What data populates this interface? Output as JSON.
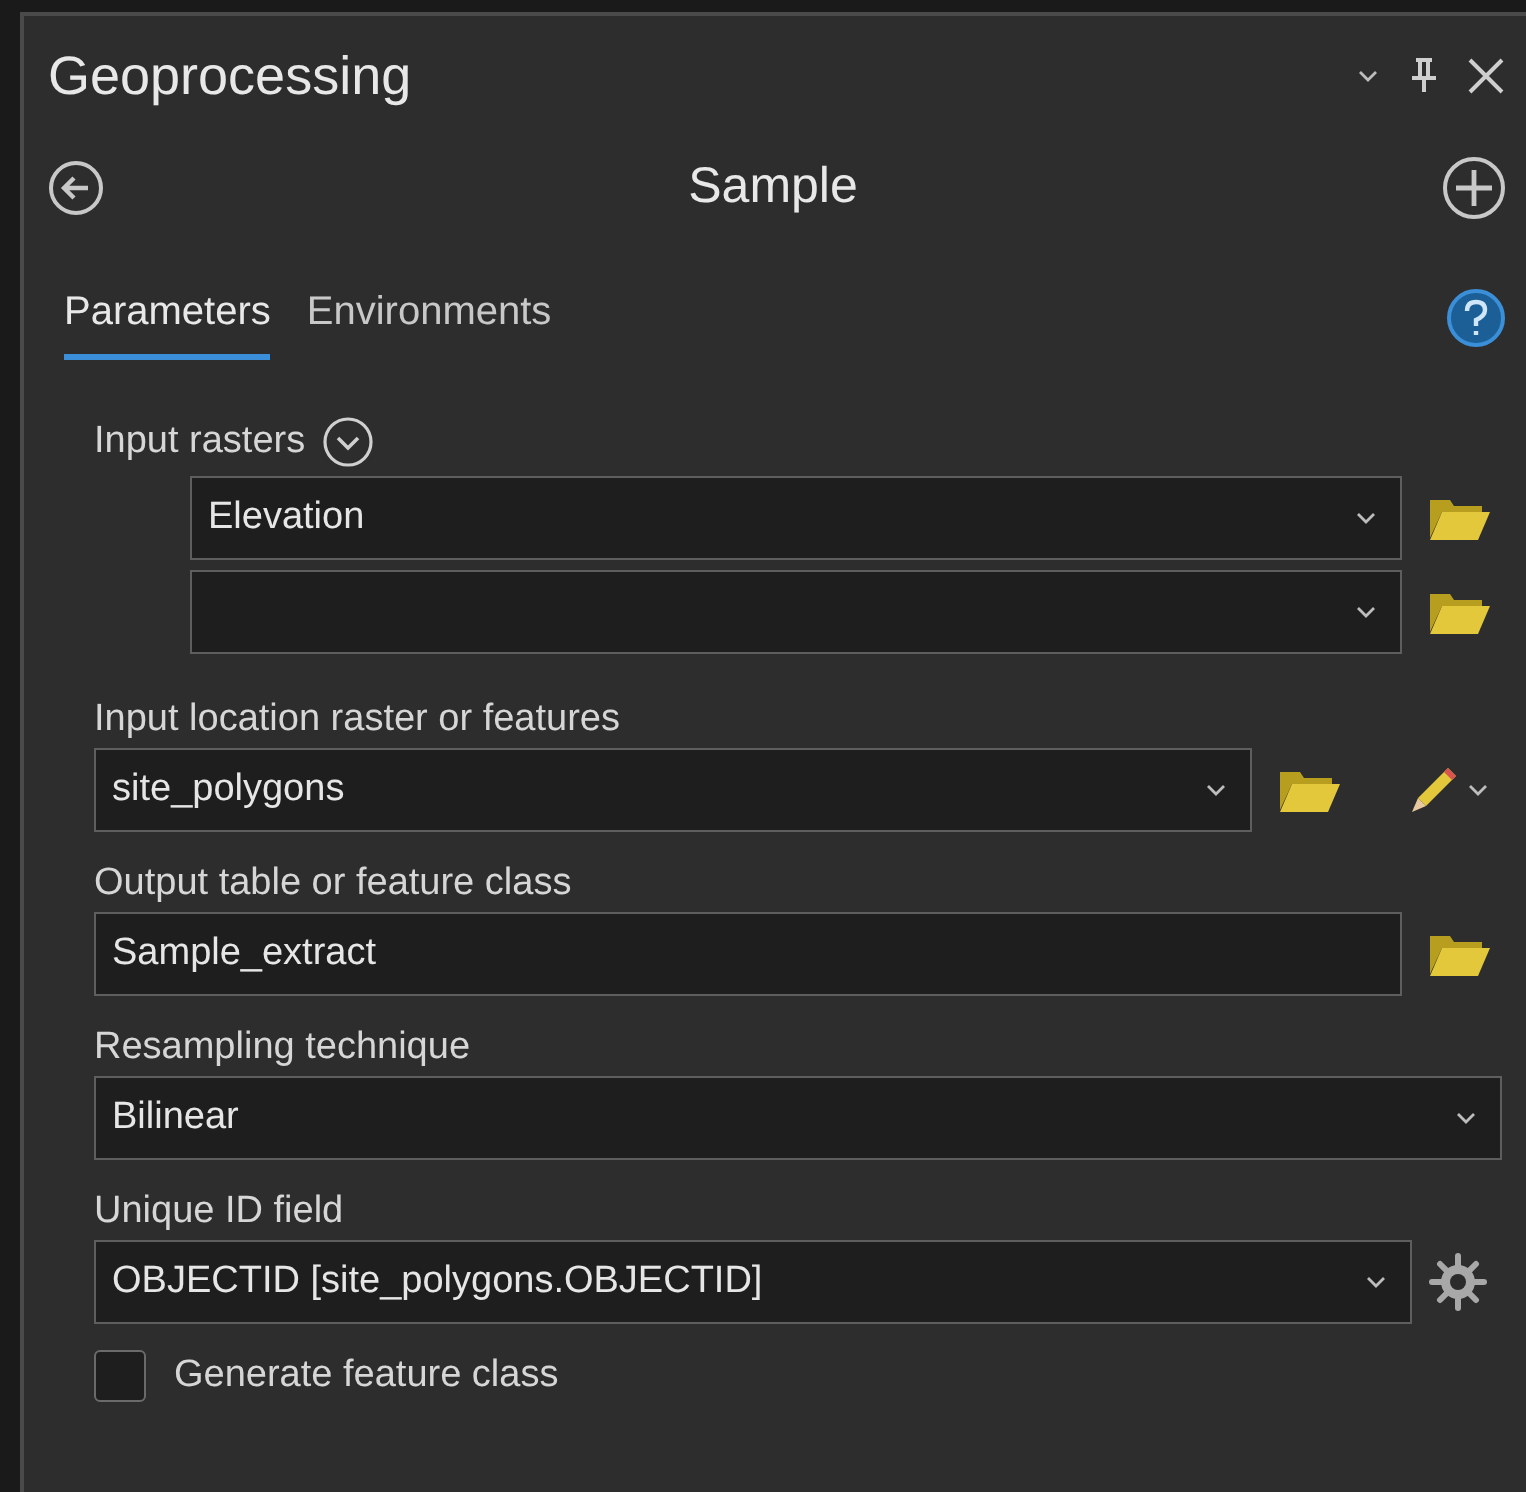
{
  "panel": {
    "title": "Geoprocessing"
  },
  "tool": {
    "title": "Sample"
  },
  "tabs": [
    {
      "label": "Parameters",
      "selected": true
    },
    {
      "label": "Environments",
      "selected": false
    }
  ],
  "parameters": [
    {
      "kind": "multi_raster",
      "label": "Input rasters",
      "rows": [
        {
          "value": "Elevation"
        },
        {}
      ]
    },
    {
      "kind": "location",
      "label": "Input location raster or features",
      "value": "site_polygons"
    },
    {
      "kind": "output",
      "label": "Output table or feature class",
      "value": "Sample_extract"
    },
    {
      "kind": "choice",
      "label": "Resampling technique",
      "value": "Bilinear"
    },
    {
      "kind": "id_field",
      "label": "Unique ID field",
      "value": "OBJECTID [site_polygons.OBJECTID]"
    },
    {
      "kind": "checkbox",
      "label": "Generate feature class",
      "checked": false
    }
  ]
}
